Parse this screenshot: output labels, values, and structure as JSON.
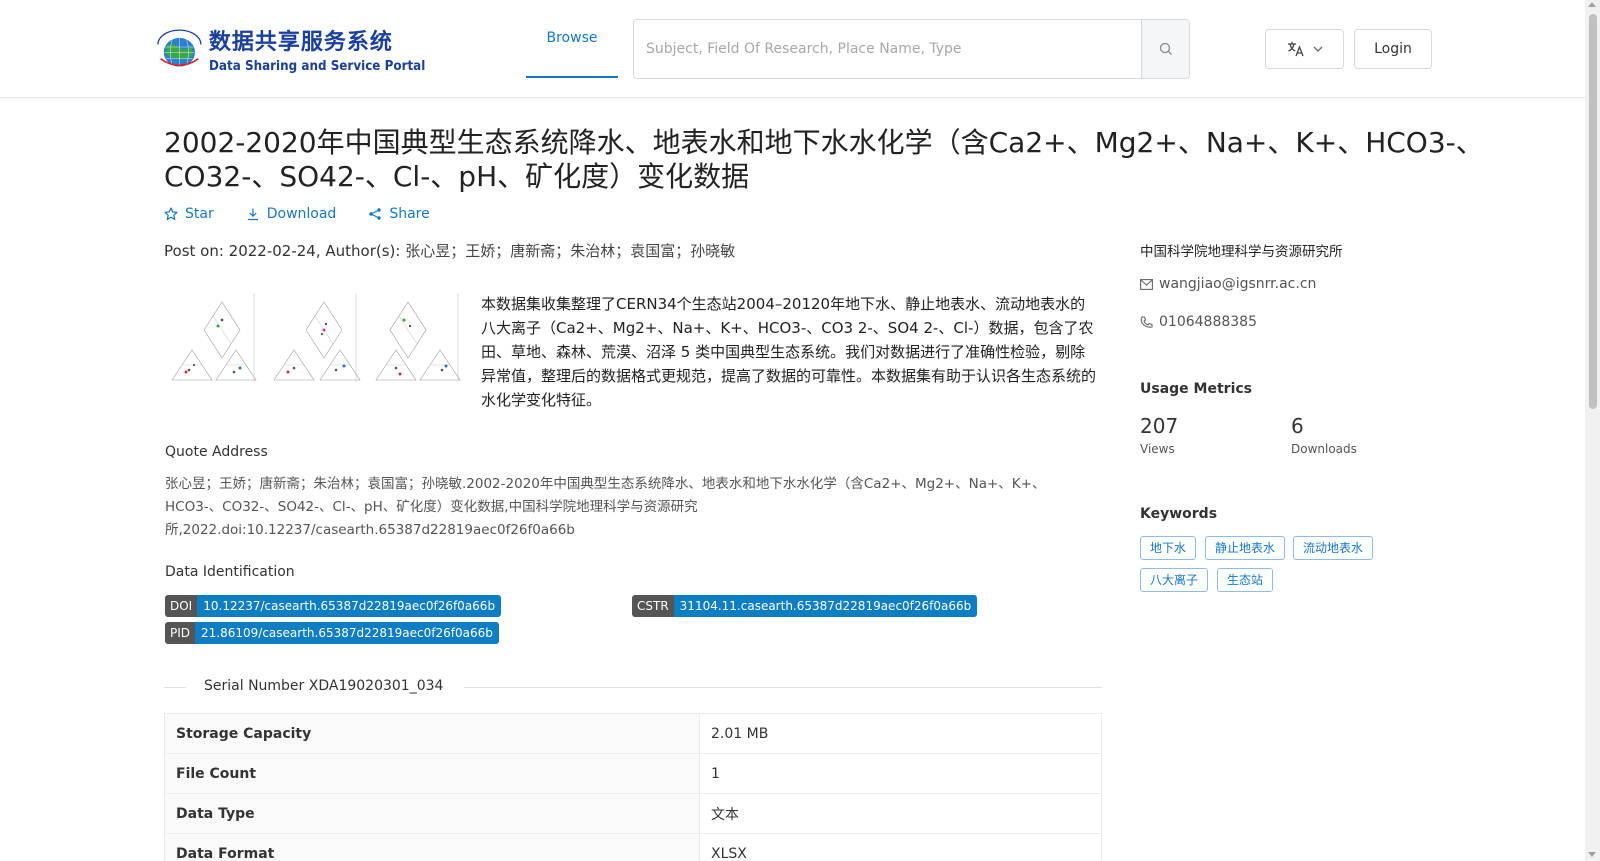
{
  "header": {
    "logo": {
      "cn_title": "数据共享服务系统",
      "en_title": "Data Sharing and Service Portal"
    },
    "nav_browse": "Browse",
    "search_placeholder": "Subject, Field Of Research, Place Name, Type",
    "login": "Login"
  },
  "dataset": {
    "title": "2002-2020年中国典型生态系统降水、地表水和地下水水化学（含Ca2+、Mg2+、Na+、K+、HCO3-、CO32-、SO42-、Cl-、pH、矿化度）变化数据",
    "actions": {
      "star": "Star",
      "download": "Download",
      "share": "Share"
    },
    "post_label": "Post on: 2022-02-24, Author(s):",
    "authors": "张心昱；王娇；唐新斋；朱治林；袁国富；孙晓敏",
    "abstract": "本数据集收集整理了CERN34个生态站2004–20120年地下水、静止地表水、流动地表水的八大离子（Ca2+、Mg2+、Na+、K+、HCO3-、CO3 2-、SO4 2-、Cl-）数据，包含了农田、草地、森林、荒漠、沼泽 5 类中国典型生态系统。我们对数据进行了准确性检验，剔除异常值，整理后的数据格式更规范，提高了数据的可靠性。本数据集有助于认识各生态系统的水化学变化特征。",
    "quote_label": "Quote Address",
    "quote_text": "张心昱；王娇；唐新斋；朱治林；袁国富；孙晓敏.2002-2020年中国典型生态系统降水、地表水和地下水水化学（含Ca2+、Mg2+、Na+、K+、HCO3-、CO32-、SO42-、Cl-、pH、矿化度）变化数据,中国科学院地理科学与资源研究所,2022.doi:10.12237/casearth.65387d22819aec0f26f0a66b",
    "identification_label": "Data Identification",
    "identifiers": {
      "doi_key": "DOI",
      "doi": "10.12237/casearth.65387d22819aec0f26f0a66b",
      "cstr_key": "CSTR",
      "cstr": "31104.11.casearth.65387d22819aec0f26f0a66b",
      "pid_key": "PID",
      "pid": "21.86109/casearth.65387d22819aec0f26f0a66b"
    },
    "serial_number": "Serial Number XDA19020301_034",
    "properties": [
      {
        "label": "Storage Capacity",
        "value": "2.01 MB"
      },
      {
        "label": "File Count",
        "value": "1"
      },
      {
        "label": "Data Type",
        "value": "文本"
      },
      {
        "label": "Data Format",
        "value": "XLSX"
      }
    ]
  },
  "sidebar": {
    "org": "中国科学院地理科学与资源研究所",
    "email": "wangjiao@igsnrr.ac.cn",
    "phone": "01064888385",
    "metrics_title": "Usage Metrics",
    "views": "207",
    "views_label": "Views",
    "downloads": "6",
    "downloads_label": "Downloads",
    "keywords_title": "Keywords",
    "keywords": [
      "地下水",
      "静止地表水",
      "流动地表水",
      "八大离子",
      "生态站"
    ]
  },
  "colors": {
    "accent": "#1677c9",
    "tag_value_bg": "#0d7dc4",
    "tag_key_bg": "#555555"
  }
}
